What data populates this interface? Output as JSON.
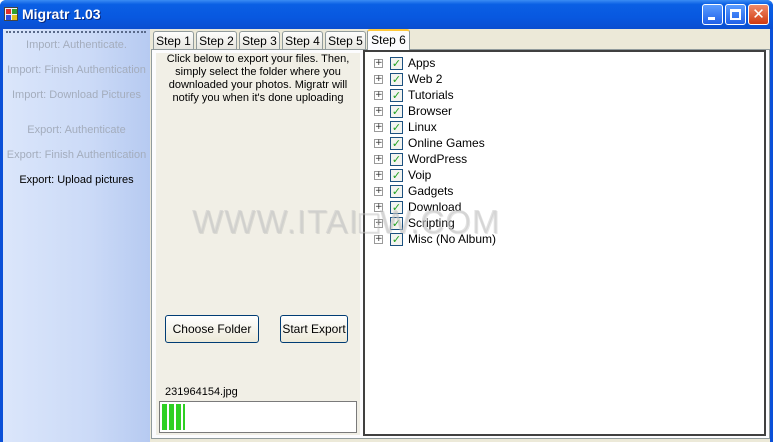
{
  "window": {
    "title": "Migratr 1.03"
  },
  "sidebar": {
    "items": [
      {
        "label": "Import:  Authenticate."
      },
      {
        "label": "Import:  Finish Authentication"
      },
      {
        "label": "Import:  Download Pictures"
      },
      {
        "label": "Export:  Authenticate"
      },
      {
        "label": "Export:  Finish Authentication"
      },
      {
        "label": "Export:  Upload pictures"
      }
    ],
    "active_item": "Export:  Upload pictures"
  },
  "tabs": [
    {
      "label": "Step 1"
    },
    {
      "label": "Step 2"
    },
    {
      "label": "Step 3"
    },
    {
      "label": "Step 4"
    },
    {
      "label": "Step 5"
    },
    {
      "label": "Step 6"
    }
  ],
  "active_tab": "Step 6",
  "export_panel": {
    "instructions": [
      "Click below to export your files.  Then,",
      "simply select the folder where you",
      "downloaded your photos.  Migratr will",
      "notify you when it's done uploading"
    ],
    "choose_folder_label": "Choose Folder",
    "start_export_label": "Start Export",
    "current_file": "231964154.jpg",
    "progress_fraction": 0.12
  },
  "album_tree": {
    "items": [
      {
        "label": "Apps",
        "checked": true
      },
      {
        "label": "Web 2",
        "checked": true
      },
      {
        "label": "Tutorials",
        "checked": true
      },
      {
        "label": "Browser",
        "checked": true
      },
      {
        "label": "Linux",
        "checked": true
      },
      {
        "label": "Online Games",
        "checked": true
      },
      {
        "label": "WordPress",
        "checked": true
      },
      {
        "label": "Voip",
        "checked": true
      },
      {
        "label": "Gadgets",
        "checked": true
      },
      {
        "label": "Download",
        "checked": true
      },
      {
        "label": "Scripting",
        "checked": true
      },
      {
        "label": "Misc (No Album)",
        "checked": true
      }
    ]
  },
  "watermark": "WWW.ITAI□W.COM",
  "colors": {
    "titlebar": "#0a5fe4",
    "sidebar": "#cbdaf7",
    "progress": "#2ed023",
    "active_tab_highlight": "#ffc83c"
  }
}
